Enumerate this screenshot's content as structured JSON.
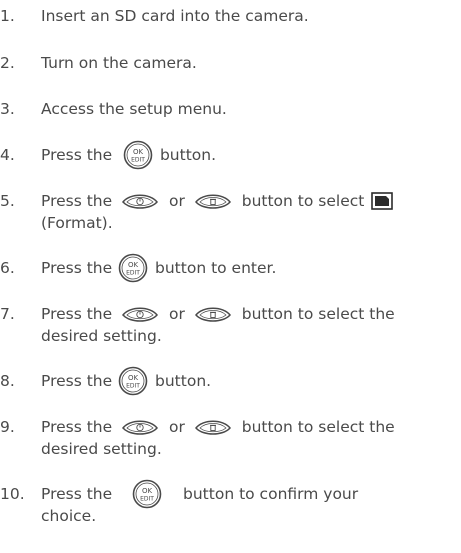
{
  "steps": [
    {
      "num": "1.",
      "parts": [
        "Insert an SD card into the camera."
      ]
    },
    {
      "num": "2.",
      "parts": [
        "Turn on the camera."
      ]
    },
    {
      "num": "3.",
      "parts": [
        "Access the setup menu."
      ]
    },
    {
      "num": "4.",
      "parts": [
        "Press the ",
        "button."
      ]
    },
    {
      "num": "5.",
      "parts": [
        "Press the ",
        " or ",
        " button to select ",
        "(Format)."
      ]
    },
    {
      "num": "6.",
      "parts": [
        "Press the ",
        " button to enter."
      ]
    },
    {
      "num": "7.",
      "parts": [
        "Press the ",
        " or ",
        " button to select the",
        "desired setting."
      ]
    },
    {
      "num": "8.",
      "parts": [
        "Press the ",
        " button."
      ]
    },
    {
      "num": "9.",
      "parts": [
        "Press the ",
        " or ",
        " button to select the",
        "desired setting."
      ]
    },
    {
      "num": "10.",
      "parts": [
        "Press the ",
        " button to confirm your",
        "choice."
      ]
    }
  ],
  "icons": {
    "ok_button": {
      "top": "OK",
      "bottom": "EDIT",
      "name": "ok-edit-button-icon"
    },
    "left_button": {
      "name": "self-timer-button-icon"
    },
    "right_button": {
      "name": "delete-button-icon"
    },
    "format": {
      "name": "sd-card-format-icon"
    }
  }
}
